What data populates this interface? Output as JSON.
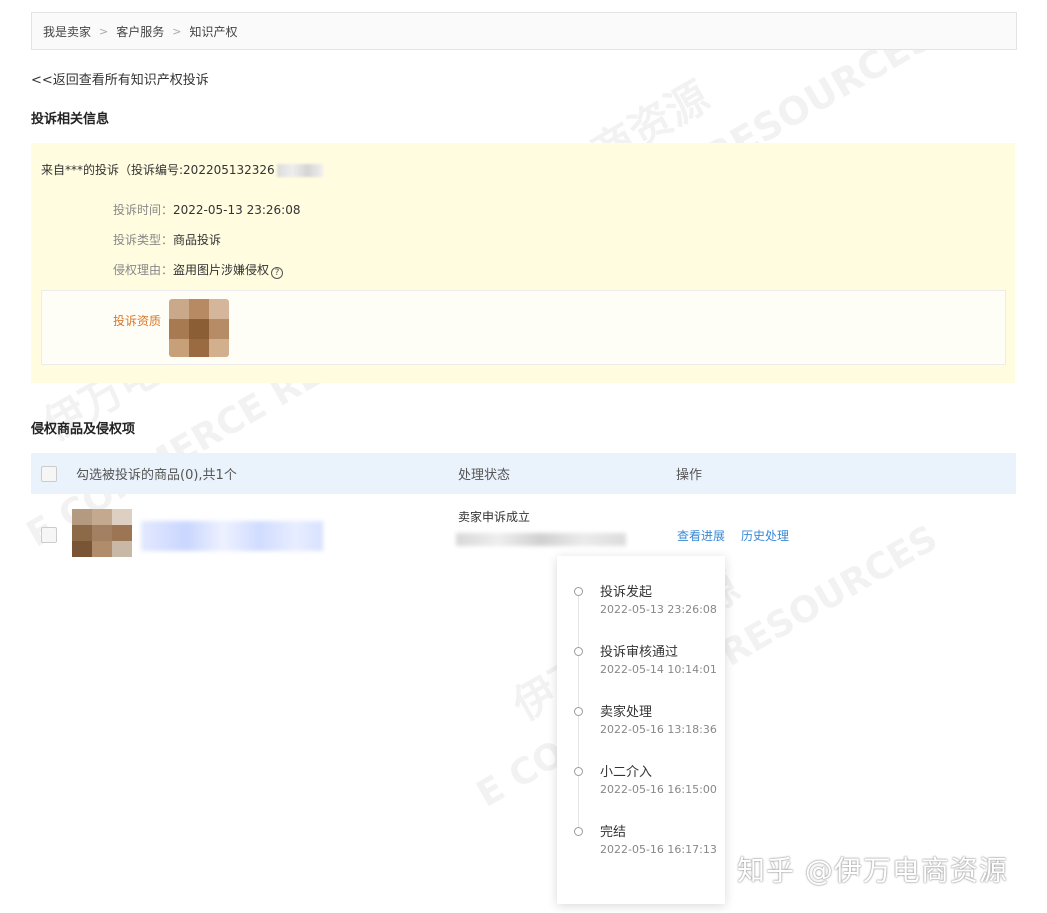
{
  "breadcrumb": [
    "我是卖家",
    "客户服务",
    "知识产权"
  ],
  "back_link": "<<返回查看所有知识产权投诉",
  "section_info_title": "投诉相关信息",
  "complaint": {
    "source": "来自***的投诉（投诉编号:202205132326",
    "fields": [
      {
        "key": "投诉时间：",
        "value": "2022-05-13 23:26:08"
      },
      {
        "key": "投诉类型：",
        "value": "商品投诉"
      },
      {
        "key": "侵权理由：",
        "value": "盗用图片涉嫌侵权"
      }
    ],
    "help_icon": "?",
    "qualification_label": "投诉资质"
  },
  "section_items_title": "侵权商品及侵权项",
  "table": {
    "header_select": "勾选被投诉的商品(0),共1个",
    "header_status": "处理状态",
    "header_action": "操作",
    "row": {
      "status": "卖家申诉成立",
      "action_progress": "查看进展",
      "action_history": "历史处理"
    }
  },
  "timeline": [
    {
      "title": "投诉发起",
      "time": "2022-05-13 23:26:08"
    },
    {
      "title": "投诉审核通过",
      "time": "2022-05-14 10:14:01"
    },
    {
      "title": "卖家处理",
      "time": "2022-05-16 13:18:36"
    },
    {
      "title": "小二介入",
      "time": "2022-05-16 16:15:00"
    },
    {
      "title": "完结",
      "time": "2022-05-16 16:17:13"
    }
  ],
  "watermark": {
    "cn": "伊万电商资源",
    "en": "E COMMERCE RESOURCES",
    "credit": "知乎 @伊万电商资源"
  },
  "colors": {
    "info_bg": "#fffce0",
    "table_header_bg": "#eaf3fc",
    "link": "#3a89d6",
    "qualification_label": "#d8782a"
  }
}
